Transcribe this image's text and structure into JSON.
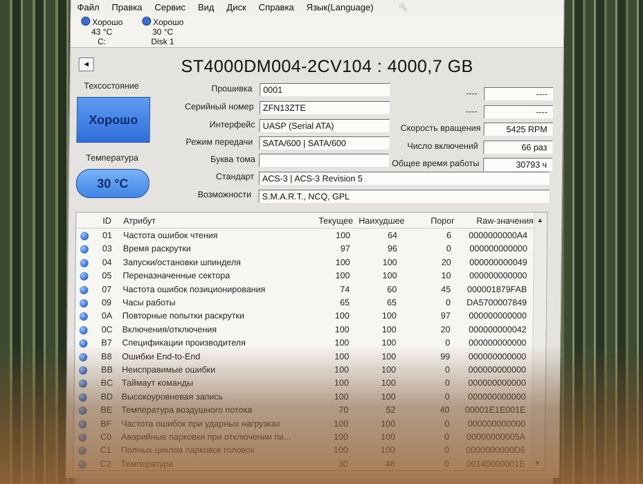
{
  "menu": [
    "Файл",
    "Правка",
    "Сервис",
    "Вид",
    "Диск",
    "Справка",
    "Язык(Language)"
  ],
  "disks": [
    {
      "status": "Хорошо",
      "temp": "43 °C",
      "name": "C:"
    },
    {
      "status": "Хорошо",
      "temp": "30 °C",
      "name": "Disk 1"
    }
  ],
  "nav": {
    "prev_glyph": "◄"
  },
  "model_title": "ST4000DM004-2CV104 : 4000,7 GB",
  "health": {
    "label": "Техсостояние",
    "status": "Хорошо"
  },
  "temperature": {
    "label": "Температура",
    "value": "30 °C"
  },
  "info": {
    "firmware_label": "Прошивка",
    "firmware": "0001",
    "serial_label": "Серийный номер",
    "serial": "ZFN13ZTE",
    "interface_label": "Интерфейс",
    "interface": "UASP (Serial ATA)",
    "transfer_label": "Режим передачи",
    "transfer": "SATA/600 | SATA/600",
    "volume_label": "Буква тома",
    "volume": "",
    "standard_label": "Стандарт",
    "standard": "ACS-3 | ACS-3 Revision 5",
    "features_label": "Возможности",
    "features": "S.M.A.R.T., NCQ, GPL"
  },
  "right_info": {
    "r1_label": "----",
    "r1_value": "----",
    "r2_label": "----",
    "r2_value": "----",
    "rpm_label": "Скорость вращения",
    "rpm": "5425 RPM",
    "power_count_label": "Число включений",
    "power_count": "66 раз",
    "hours_label": "Общее время работы",
    "hours": "30793 ч"
  },
  "table": {
    "headers": {
      "id": "ID",
      "attr": "Атрибут",
      "current": "Текущее",
      "worst": "Наихудшее",
      "threshold": "Порог",
      "raw": "Raw-значения"
    },
    "rows": [
      {
        "id": "01",
        "attr": "Частота ошибок чтения",
        "current": "100",
        "worst": "64",
        "threshold": "6",
        "raw": "0000000000A4"
      },
      {
        "id": "03",
        "attr": "Время раскрутки",
        "current": "97",
        "worst": "96",
        "threshold": "0",
        "raw": "000000000000"
      },
      {
        "id": "04",
        "attr": "Запуски/остановки шпинделя",
        "current": "100",
        "worst": "100",
        "threshold": "20",
        "raw": "000000000049"
      },
      {
        "id": "05",
        "attr": "Переназначенные сектора",
        "current": "100",
        "worst": "100",
        "threshold": "10",
        "raw": "000000000000"
      },
      {
        "id": "07",
        "attr": "Частота ошибок позиционирования",
        "current": "74",
        "worst": "60",
        "threshold": "45",
        "raw": "000001879FAB"
      },
      {
        "id": "09",
        "attr": "Часы работы",
        "current": "65",
        "worst": "65",
        "threshold": "0",
        "raw": "DA5700007849"
      },
      {
        "id": "0A",
        "attr": "Повторные попытки раскрутки",
        "current": "100",
        "worst": "100",
        "threshold": "97",
        "raw": "000000000000"
      },
      {
        "id": "0C",
        "attr": "Включения/отключения",
        "current": "100",
        "worst": "100",
        "threshold": "20",
        "raw": "000000000042"
      },
      {
        "id": "B7",
        "attr": "Спецификации производителя",
        "current": "100",
        "worst": "100",
        "threshold": "0",
        "raw": "000000000000"
      },
      {
        "id": "B8",
        "attr": "Ошибки End-to-End",
        "current": "100",
        "worst": "100",
        "threshold": "99",
        "raw": "000000000000"
      },
      {
        "id": "BB",
        "attr": "Неисправимые ошибки",
        "current": "100",
        "worst": "100",
        "threshold": "0",
        "raw": "000000000000"
      },
      {
        "id": "BC",
        "attr": "Таймаут команды",
        "current": "100",
        "worst": "100",
        "threshold": "0",
        "raw": "000000000000"
      },
      {
        "id": "BD",
        "attr": "Высокоуровневая запись",
        "current": "100",
        "worst": "100",
        "threshold": "0",
        "raw": "000000000000"
      },
      {
        "id": "BE",
        "attr": "Температура воздушного потока",
        "current": "70",
        "worst": "52",
        "threshold": "40",
        "raw": "00001E1E001E"
      },
      {
        "id": "BF",
        "attr": "Частота ошибок при ударных нагрузках",
        "current": "100",
        "worst": "100",
        "threshold": "0",
        "raw": "000000000000"
      },
      {
        "id": "C0",
        "attr": "Аварийные парковки при отключении пи...",
        "current": "100",
        "worst": "100",
        "threshold": "0",
        "raw": "00000000005A"
      },
      {
        "id": "C1",
        "attr": "Полных циклов парковок головок",
        "current": "100",
        "worst": "100",
        "threshold": "0",
        "raw": "0000000000D6"
      },
      {
        "id": "C2",
        "attr": "Температура",
        "current": "30",
        "worst": "48",
        "threshold": "0",
        "raw": "00140000001E"
      }
    ]
  }
}
